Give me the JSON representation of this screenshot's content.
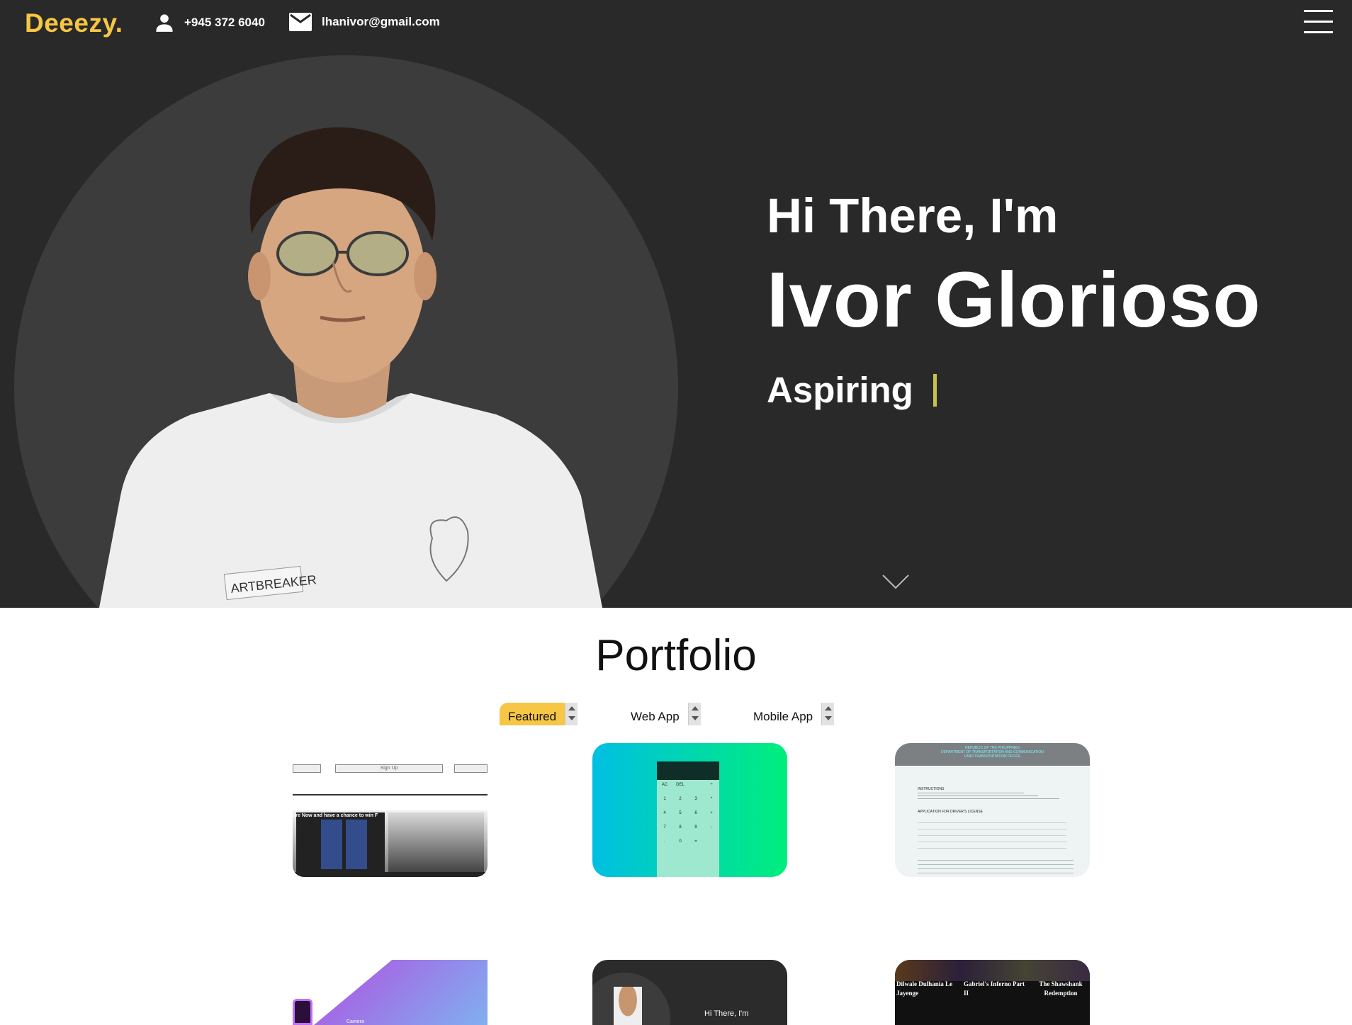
{
  "header": {
    "logo": "Deeezy.",
    "phone": "+945 372 6040",
    "email": "lhanivor@gmail.com"
  },
  "hero": {
    "greeting": "Hi There, I'm",
    "name": "Ivor Glorioso",
    "role": "Aspiring"
  },
  "portfolio": {
    "title": "Portfolio",
    "filters": [
      {
        "label": "Featured",
        "active": true
      },
      {
        "label": "Web App",
        "active": false
      },
      {
        "label": "Mobile App",
        "active": false
      }
    ],
    "cards": [
      {
        "caption_1": "ure Now and have a chance to win F",
        "caption_2": "Sign Up"
      },
      {
        "calc_keys": [
          "AC",
          "DEL",
          "÷",
          "1",
          "2",
          "3",
          "*",
          "4",
          "5",
          "6",
          "+",
          "7",
          "8",
          "9",
          "-",
          ".",
          "0",
          "="
        ]
      },
      {
        "heading_1": "REPUBLIC OF THE PHILIPPINES",
        "heading_2": "DEPARTMENT OF TRANSPORTATION AND COMMUNICATION",
        "heading_3": "LAND TRANSPORTATION OFFICE",
        "section": "INSTRUCTIONS",
        "form_title": "APPLICATION FOR DRIVER'S LICENSE"
      },
      {
        "caption": "Camera"
      },
      {
        "caption": "Hi There, I'm"
      },
      {
        "movies": [
          "Dilwale Dulhania Le Jayenge",
          "Gabriel's Inferno Part II",
          "The Shawshank Redemption"
        ]
      }
    ]
  },
  "colors": {
    "accent": "#f6c644",
    "hero_bg": "#292929",
    "circle_bg": "#3c3c3c"
  }
}
